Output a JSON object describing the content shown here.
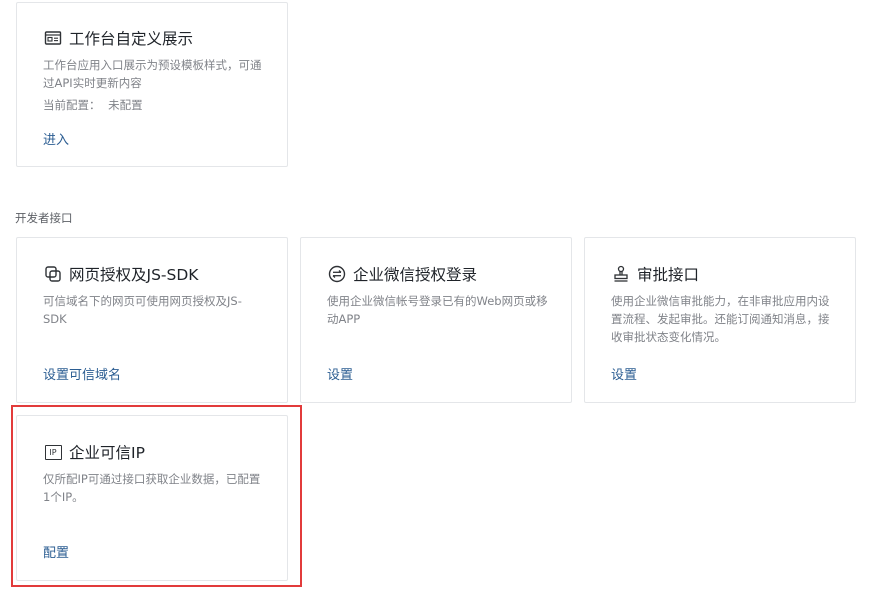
{
  "workbench": {
    "title": "工作台自定义展示",
    "icon": "display-card-icon",
    "description": "工作台应用入口展示为预设模板样式，可通过API实时更新内容",
    "config_label": "当前配置：",
    "config_value": "未配置",
    "link": "进入"
  },
  "developer_section": {
    "label": "开发者接口",
    "cards": [
      {
        "title": "网页授权及JS-SDK",
        "icon": "overlapping-squares-icon",
        "description": "可信域名下的网页可使用网页授权及JS-SDK",
        "link": "设置可信域名"
      },
      {
        "title": "企业微信授权登录",
        "icon": "exchange-arrows-icon",
        "description": "使用企业微信帐号登录已有的Web网页或移动APP",
        "link": "设置"
      },
      {
        "title": "审批接口",
        "icon": "stamp-icon",
        "description": "使用企业微信审批能力，在非审批应用内设置流程、发起审批。还能订阅通知消息，接收审批状态变化情况。",
        "link": "设置"
      },
      {
        "title": "企业可信IP",
        "icon": "ip-box-icon",
        "icon_text": "IP",
        "description": "仅所配IP可通过接口获取企业数据，已配置1个IP。",
        "link": "配置"
      }
    ]
  },
  "colors": {
    "link": "#2b5d92",
    "highlight": "#e23b3b",
    "border": "#e4e6e9",
    "muted_text": "#808389"
  }
}
